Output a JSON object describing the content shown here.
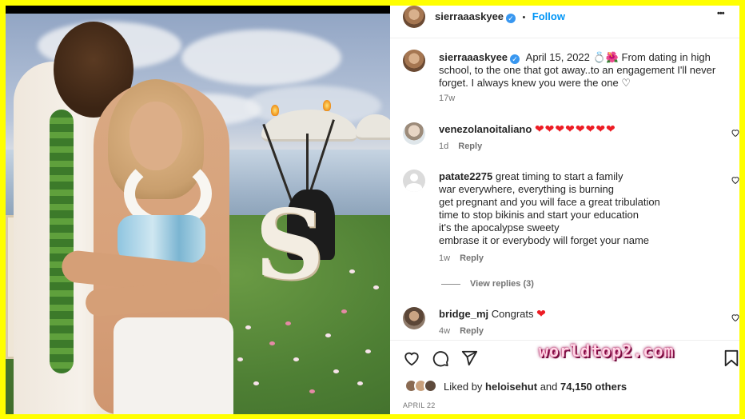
{
  "post": {
    "author": "sierraaaskyee",
    "follow_label": "Follow",
    "more_label": "•••",
    "separator": "•"
  },
  "caption": {
    "author": "sierraaaskyee",
    "date": "April 15, 2022",
    "emojis": "💍🌺",
    "text": "From dating in high school, to the one that got away..to an engagement I'll never forget. I always knew you were the one ♡",
    "age": "17w"
  },
  "comments": [
    {
      "user": "venezolanoitaliano",
      "text": "❤❤❤❤❤❤❤❤",
      "age": "1d",
      "reply_label": "Reply"
    },
    {
      "user": "patate2275",
      "lines": [
        "great timing to start a family",
        "war everywhere, everything is burning",
        "get pregnant and you will face a great tribulation",
        "time to stop bikinis and start your education",
        "it's the apocalypse sweety",
        "embrase it or everybody will forget your name"
      ],
      "age": "1w",
      "reply_label": "Reply",
      "view_replies": "View replies (3)"
    },
    {
      "user": "bridge_mj",
      "text": "Congrats",
      "heart": "❤",
      "age": "4w",
      "reply_label": "Reply"
    }
  ],
  "actions": {
    "like_icon": "heart-outline-icon",
    "comment_icon": "comment-icon",
    "share_icon": "paper-plane-icon",
    "save_icon": "bookmark-icon"
  },
  "likes": {
    "prefix": "Liked by",
    "user": "heloisehut",
    "middle": "and",
    "count": "74,150 others"
  },
  "post_date": "APRIL 22",
  "watermark": "worldtop2.com",
  "colors": {
    "frame": "#ffff00",
    "link_blue": "#0095f6",
    "verified_blue": "#3897f0",
    "heart_red": "#ed1c24"
  }
}
